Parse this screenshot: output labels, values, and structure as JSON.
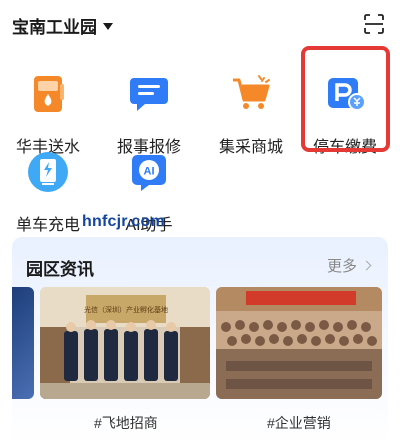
{
  "header": {
    "location": "宝南工业园"
  },
  "services": [
    {
      "label": "华丰送水",
      "icon": "water-delivery-icon"
    },
    {
      "label": "报事报修",
      "icon": "report-repair-icon"
    },
    {
      "label": "集采商城",
      "icon": "shopping-cart-icon"
    },
    {
      "label": "停车缴费",
      "icon": "parking-payment-icon"
    },
    {
      "label": "单车充电",
      "icon": "bike-charging-icon"
    },
    {
      "label": "AI助手",
      "icon": "ai-assistant-icon"
    }
  ],
  "watermark": "hnfcjr.com",
  "news": {
    "title": "园区资讯",
    "more_label": "更多",
    "items": [
      {
        "tag": "#飞地招商",
        "sign_text": "光信（深圳）产业孵化基地"
      },
      {
        "tag": "#企业营销",
        "sign_text": ""
      }
    ]
  },
  "colors": {
    "accent_blue": "#2f7cf6",
    "orange": "#f5892a",
    "highlight_red": "#e53935",
    "watermark_blue": "#1446a0"
  }
}
